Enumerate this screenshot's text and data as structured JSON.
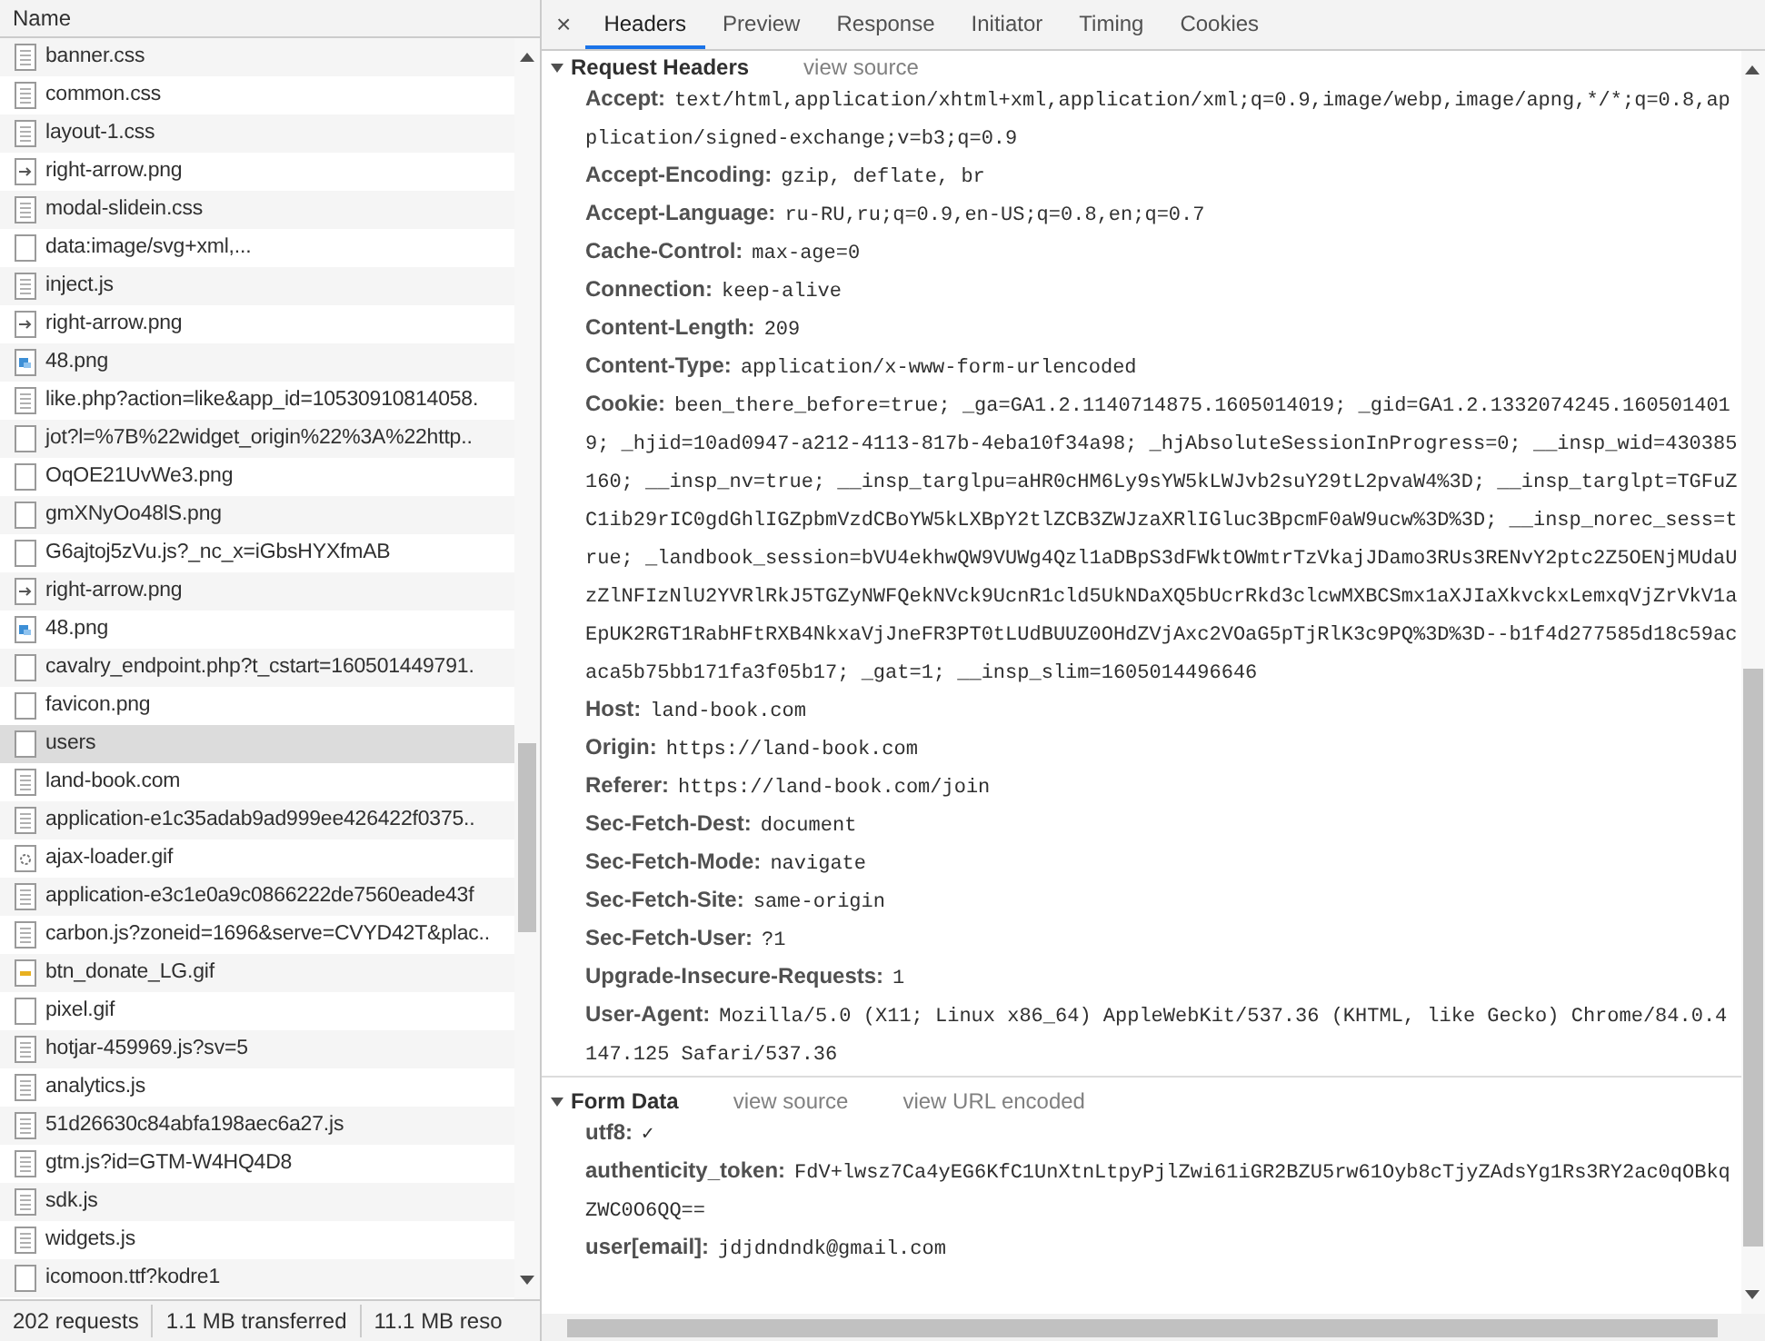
{
  "request_list": {
    "column_header": "Name",
    "rows": [
      {
        "name": "banner.css",
        "kind": "doc",
        "selected": false
      },
      {
        "name": "common.css",
        "kind": "doc",
        "selected": false
      },
      {
        "name": "layout-1.css",
        "kind": "doc",
        "selected": false
      },
      {
        "name": "right-arrow.png",
        "kind": "redirect",
        "selected": false
      },
      {
        "name": "modal-slidein.css",
        "kind": "doc",
        "selected": false
      },
      {
        "name": "data:image/svg+xml,...",
        "kind": "blank",
        "selected": false
      },
      {
        "name": "inject.js",
        "kind": "doc",
        "selected": false
      },
      {
        "name": "right-arrow.png",
        "kind": "redirect",
        "selected": false
      },
      {
        "name": "48.png",
        "kind": "image",
        "selected": false
      },
      {
        "name": "like.php?action=like&app_id=10530910814058.",
        "kind": "doc",
        "selected": false
      },
      {
        "name": "jot?l=%7B%22widget_origin%22%3A%22http..",
        "kind": "blank",
        "selected": false
      },
      {
        "name": "OqOE21UvWe3.png",
        "kind": "blank",
        "selected": false
      },
      {
        "name": "gmXNyOo48lS.png",
        "kind": "blank",
        "selected": false
      },
      {
        "name": "G6ajtoj5zVu.js?_nc_x=iGbsHYXfmAB",
        "kind": "blank",
        "selected": false
      },
      {
        "name": "right-arrow.png",
        "kind": "redirect",
        "selected": false
      },
      {
        "name": "48.png",
        "kind": "image",
        "selected": false
      },
      {
        "name": "cavalry_endpoint.php?t_cstart=160501449791.",
        "kind": "blank",
        "selected": false
      },
      {
        "name": "favicon.png",
        "kind": "blank",
        "selected": false
      },
      {
        "name": "users",
        "kind": "blank",
        "selected": true
      },
      {
        "name": "land-book.com",
        "kind": "doc",
        "selected": false
      },
      {
        "name": "application-e1c35adab9ad999ee426422f0375..",
        "kind": "doc",
        "selected": false
      },
      {
        "name": "ajax-loader.gif",
        "kind": "loader",
        "selected": false
      },
      {
        "name": "application-e3c1e0a9c0866222de7560eade43f",
        "kind": "doc",
        "selected": false
      },
      {
        "name": "carbon.js?zoneid=1696&serve=CVYD42T&plac..",
        "kind": "doc",
        "selected": false
      },
      {
        "name": "btn_donate_LG.gif",
        "kind": "gif",
        "selected": false
      },
      {
        "name": "pixel.gif",
        "kind": "blank",
        "selected": false
      },
      {
        "name": "hotjar-459969.js?sv=5",
        "kind": "doc",
        "selected": false
      },
      {
        "name": "analytics.js",
        "kind": "doc",
        "selected": false
      },
      {
        "name": "51d26630c84abfa198aec6a27.js",
        "kind": "doc",
        "selected": false
      },
      {
        "name": "gtm.js?id=GTM-W4HQ4D8",
        "kind": "doc",
        "selected": false
      },
      {
        "name": "sdk.js",
        "kind": "doc",
        "selected": false
      },
      {
        "name": "widgets.js",
        "kind": "doc",
        "selected": false
      },
      {
        "name": "icomoon.ttf?kodre1",
        "kind": "blank",
        "selected": false
      }
    ]
  },
  "status_bar": [
    "202 requests",
    "1.1 MB transferred",
    "11.1 MB reso"
  ],
  "detail": {
    "close": "×",
    "tabs": [
      {
        "label": "Headers",
        "selected": true
      },
      {
        "label": "Preview",
        "selected": false
      },
      {
        "label": "Response",
        "selected": false
      },
      {
        "label": "Initiator",
        "selected": false
      },
      {
        "label": "Timing",
        "selected": false
      },
      {
        "label": "Cookies",
        "selected": false
      }
    ],
    "sections": [
      {
        "title": "Request Headers",
        "links": [
          "view source"
        ],
        "expanded": true,
        "entries": [
          {
            "key": "Accept:",
            "value": "text/html,application/xhtml+xml,application/xml;q=0.9,image/webp,image/apng,*/*;q=0.8,application/signed-exchange;v=b3;q=0.9"
          },
          {
            "key": "Accept-Encoding:",
            "value": "gzip, deflate, br"
          },
          {
            "key": "Accept-Language:",
            "value": "ru-RU,ru;q=0.9,en-US;q=0.8,en;q=0.7"
          },
          {
            "key": "Cache-Control:",
            "value": "max-age=0"
          },
          {
            "key": "Connection:",
            "value": "keep-alive"
          },
          {
            "key": "Content-Length:",
            "value": "209"
          },
          {
            "key": "Content-Type:",
            "value": "application/x-www-form-urlencoded"
          },
          {
            "key": "Cookie:",
            "value": "been_there_before=true; _ga=GA1.2.1140714875.1605014019; _gid=GA1.2.1332074245.1605014019; _hjid=10ad0947-a212-4113-817b-4eba10f34a98; _hjAbsoluteSessionInProgress=0; __insp_wid=430385160; __insp_nv=true; __insp_targlpu=aHR0cHM6Ly9sYW5kLWJvb2suY29tL2pvaW4%3D; __insp_targlpt=TGFuZC1ib29rIC0gdGhlIGZpbmVzdCBoYW5kLXBpY2tlZCB3ZWJzaXRlIGluc3BpcmF0aW9ucw%3D%3D; __insp_norec_sess=true; _landbook_session=bVU4ekhwQW9VUWg4Qzl1aDBpS3dFWktOWmtrTzVkajJDamo3RUs3RENvY2ptc2Z5OENjMUdaUzZlNFIzNlU2YVRlRkJ5TGZyNWFQekNVck9UcnR1cld5UkNDaXQ5bUcrRkd3clcwMXBCSmx1aXJIaXkvckxLemxqVjZrVkV1aEpUK2RGT1RabHFtRXB4NkxaVjJneFR3PT0tLUdBUUZ0OHdZVjAxc2VOaG5pTjRlK3c9PQ%3D%3D--b1f4d277585d18c59acaca5b75bb171fa3f05b17; _gat=1; __insp_slim=1605014496646"
          },
          {
            "key": "Host:",
            "value": "land-book.com"
          },
          {
            "key": "Origin:",
            "value": "https://land-book.com"
          },
          {
            "key": "Referer:",
            "value": "https://land-book.com/join"
          },
          {
            "key": "Sec-Fetch-Dest:",
            "value": "document"
          },
          {
            "key": "Sec-Fetch-Mode:",
            "value": "navigate"
          },
          {
            "key": "Sec-Fetch-Site:",
            "value": "same-origin"
          },
          {
            "key": "Sec-Fetch-User:",
            "value": "?1"
          },
          {
            "key": "Upgrade-Insecure-Requests:",
            "value": "1"
          },
          {
            "key": "User-Agent:",
            "value": "Mozilla/5.0 (X11; Linux x86_64) AppleWebKit/537.36 (KHTML, like Gecko) Chrome/84.0.4147.125 Safari/537.36"
          }
        ]
      },
      {
        "title": "Form Data",
        "links": [
          "view source",
          "view URL encoded"
        ],
        "expanded": true,
        "entries": [
          {
            "key": "utf8:",
            "value": "✓"
          },
          {
            "key": "authenticity_token:",
            "value": "FdV+lwsz7Ca4yEG6KfC1UnXtnLtpyPjlZwi61iGR2BZU5rw61Oyb8cTjyZAdsYg1Rs3RY2ac0qOBkqZWC0O6QQ=="
          },
          {
            "key": "user[email]:",
            "value": "jdjdndndk@gmail.com"
          }
        ]
      }
    ]
  }
}
